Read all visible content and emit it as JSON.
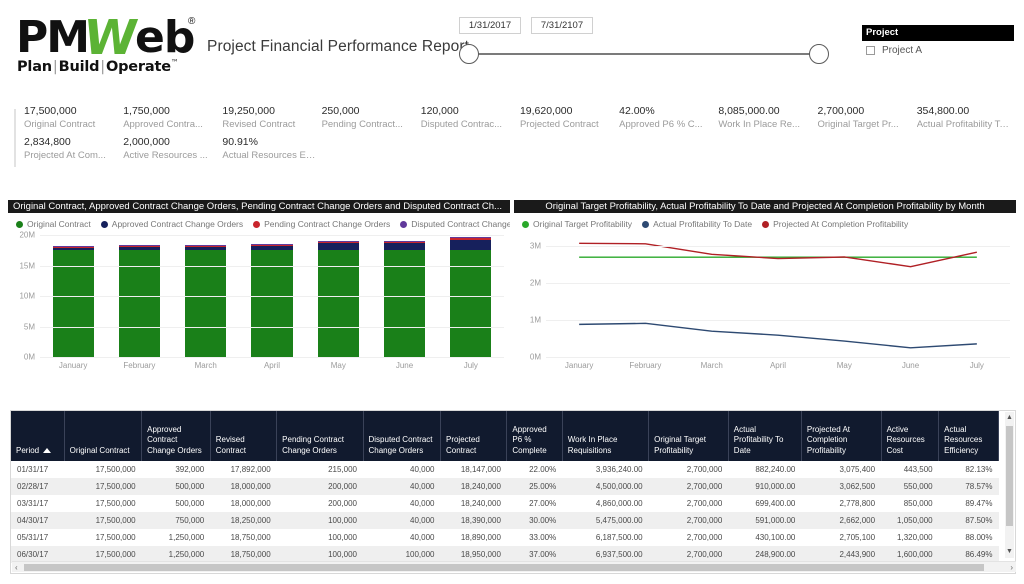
{
  "header": {
    "logo": {
      "part1": "PM",
      "part2": "W",
      "part3": "eb",
      "registered": "®",
      "tagline_plan": "Plan",
      "tagline_build": "Build",
      "tagline_operate": "Operate",
      "tagline_tm": "™",
      "sep": "|"
    },
    "report_title": "Project Financial Performance Report"
  },
  "date_slicer": {
    "from_value": "1/31/2017",
    "to_value": "7/31/2107"
  },
  "project_slicer": {
    "title": "Project",
    "items": [
      {
        "label": "Project A",
        "checked": false
      }
    ]
  },
  "kpis": [
    {
      "value": "17,500,000",
      "label": "Original Contract"
    },
    {
      "value": "1,750,000",
      "label": "Approved Contra..."
    },
    {
      "value": "19,250,000",
      "label": "Revised Contract"
    },
    {
      "value": "250,000",
      "label": "Pending Contract..."
    },
    {
      "value": "120,000",
      "label": "Disputed Contrac..."
    },
    {
      "value": "19,620,000",
      "label": "Projected Contract"
    },
    {
      "value": "42.00%",
      "label": "Approved P6 % C..."
    },
    {
      "value": "8,085,000.00",
      "label": "Work In Place Re..."
    },
    {
      "value": "2,700,000",
      "label": "Original Target Pr..."
    },
    {
      "value": "354,800.00",
      "label": "Actual Profitability To..."
    },
    {
      "value": "2,834,800",
      "label": "Projected At Com..."
    },
    {
      "value": "2,000,000",
      "label": "Active Resources ..."
    },
    {
      "value": "90.91%",
      "label": "Actual Resources Effi..."
    }
  ],
  "colors": {
    "green": "#1a8019",
    "navy": "#16205c",
    "red": "#c9252c",
    "purple": "#61399b",
    "line_green": "#2aa82a",
    "line_navy": "#2e4a72",
    "line_red": "#b02025",
    "header_bg": "#111a2e",
    "title_bg": "#1a1a1a"
  },
  "chart_data": [
    {
      "type": "bar",
      "title": "Original Contract, Approved Contract Change Orders, Pending Contract Change Orders and Disputed Contract Ch...",
      "stacked": true,
      "categories": [
        "January",
        "February",
        "March",
        "April",
        "May",
        "June",
        "July"
      ],
      "series": [
        {
          "name": "Original Contract",
          "color": "#1a8019",
          "values": [
            17500000,
            17500000,
            17500000,
            17500000,
            17500000,
            17500000,
            17500000
          ]
        },
        {
          "name": "Approved Contract Change Orders",
          "color": "#16205c",
          "values": [
            392000,
            500000,
            500000,
            750000,
            1250000,
            1250000,
            1750000
          ]
        },
        {
          "name": "Pending Contract Change Orders",
          "color": "#c9252c",
          "values": [
            215000,
            200000,
            200000,
            100000,
            100000,
            100000,
            250000
          ]
        },
        {
          "name": "Disputed Contract Change O...",
          "color": "#61399b",
          "values": [
            40000,
            40000,
            40000,
            40000,
            40000,
            100000,
            120000
          ]
        }
      ],
      "legend": [
        "Original Contract",
        "Approved Contract Change Orders",
        "Pending Contract Change Orders",
        "Disputed Contract Change O..."
      ],
      "xlabel": "",
      "ylabel": "",
      "ylim": [
        0,
        20000000
      ],
      "yticks": [
        "0M",
        "5M",
        "10M",
        "15M",
        "20M"
      ],
      "ytick_values": [
        0,
        5000000,
        10000000,
        15000000,
        20000000
      ],
      "grid": true,
      "legend_position": "top"
    },
    {
      "type": "line",
      "title": "Original Target Profitability, Actual Profitability To Date and Projected At Completion Profitability by Month",
      "categories": [
        "January",
        "February",
        "March",
        "April",
        "May",
        "June",
        "July"
      ],
      "series": [
        {
          "name": "Original Target Profitability",
          "color": "#2aa82a",
          "values": [
            2700000,
            2700000,
            2700000,
            2700000,
            2700000,
            2700000,
            2700000
          ]
        },
        {
          "name": "Actual Profitability To Date",
          "color": "#2e4a72",
          "values": [
            882240,
            910000,
            699400,
            591000,
            430100,
            248900,
            354800
          ]
        },
        {
          "name": "Projected At Completion Profitability",
          "color": "#b02025",
          "values": [
            3075400,
            3062500,
            2778800,
            2662000,
            2705100,
            2443900,
            2834800
          ]
        }
      ],
      "legend": [
        "Original Target Profitability",
        "Actual Profitability To Date",
        "Projected At Completion Profitability"
      ],
      "xlabel": "",
      "ylabel": "",
      "ylim": [
        0,
        3300000
      ],
      "yticks": [
        "0M",
        "1M",
        "2M",
        "3M"
      ],
      "ytick_values": [
        0,
        1000000,
        2000000,
        3000000
      ],
      "grid": true,
      "legend_position": "top"
    }
  ],
  "table": {
    "sort_column": "Period",
    "sort_direction": "asc",
    "columns": [
      "Period",
      "Original Contract",
      "Approved Contract Change Orders",
      "Revised Contract",
      "Pending Contract Change Orders",
      "Disputed Contract Change Orders",
      "Projected Contract",
      "Approved P6 % Complete",
      "Work In Place Requisitions",
      "Original Target Profitability",
      "Actual Profitability To Date",
      "Projected At Completion Profitability",
      "Active Resources Cost",
      "Actual Resources Efficiency"
    ],
    "rows": [
      [
        "01/31/17",
        "17,500,000",
        "392,000",
        "17,892,000",
        "215,000",
        "40,000",
        "18,147,000",
        "22.00%",
        "3,936,240.00",
        "2,700,000",
        "882,240.00",
        "3,075,400",
        "443,500",
        "82.13%"
      ],
      [
        "02/28/17",
        "17,500,000",
        "500,000",
        "18,000,000",
        "200,000",
        "40,000",
        "18,240,000",
        "25.00%",
        "4,500,000.00",
        "2,700,000",
        "910,000.00",
        "3,062,500",
        "550,000",
        "78.57%"
      ],
      [
        "03/31/17",
        "17,500,000",
        "500,000",
        "18,000,000",
        "200,000",
        "40,000",
        "18,240,000",
        "27.00%",
        "4,860,000.00",
        "2,700,000",
        "699,400.00",
        "2,778,800",
        "850,000",
        "89.47%"
      ],
      [
        "04/30/17",
        "17,500,000",
        "750,000",
        "18,250,000",
        "100,000",
        "40,000",
        "18,390,000",
        "30.00%",
        "5,475,000.00",
        "2,700,000",
        "591,000.00",
        "2,662,000",
        "1,050,000",
        "87.50%"
      ],
      [
        "05/31/17",
        "17,500,000",
        "1,250,000",
        "18,750,000",
        "100,000",
        "40,000",
        "18,890,000",
        "33.00%",
        "6,187,500.00",
        "2,700,000",
        "430,100.00",
        "2,705,100",
        "1,320,000",
        "88.00%"
      ],
      [
        "06/30/17",
        "17,500,000",
        "1,250,000",
        "18,750,000",
        "100,000",
        "100,000",
        "18,950,000",
        "37.00%",
        "6,937,500.00",
        "2,700,000",
        "248,900.00",
        "2,443,900",
        "1,600,000",
        "86.49%"
      ]
    ]
  }
}
